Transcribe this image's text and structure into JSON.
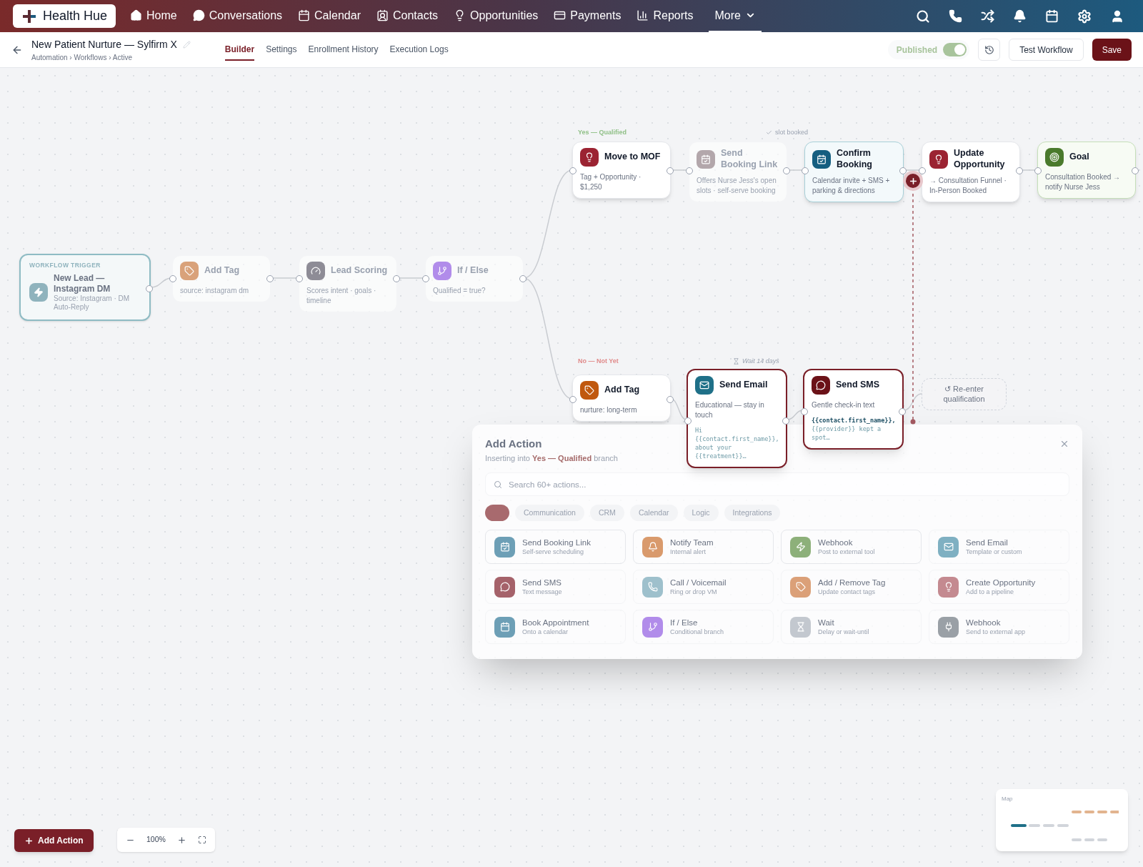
{
  "nav": {
    "brand": "Health Hue",
    "items": [
      {
        "label": "Home",
        "selected": false
      },
      {
        "label": "Conversations",
        "selected": false
      },
      {
        "label": "Calendar",
        "selected": false
      },
      {
        "label": "Contacts",
        "selected": false
      },
      {
        "label": "Opportunities",
        "selected": false
      },
      {
        "label": "Payments",
        "selected": false
      },
      {
        "label": "Reports",
        "selected": false
      },
      {
        "label": "More",
        "selected": true
      }
    ]
  },
  "header": {
    "title": "New Patient Nurture — Sylfirm X",
    "breadcrumb": "Automation › Workflows › Active",
    "tabs": [
      {
        "label": "Builder",
        "selected": true
      },
      {
        "label": "Settings",
        "selected": false
      },
      {
        "label": "Enrollment History",
        "selected": false
      },
      {
        "label": "Execution Logs",
        "selected": false
      }
    ],
    "published": {
      "label": "Published",
      "on": true
    },
    "buttons": [
      "Test Workflow",
      "Save"
    ]
  },
  "canvas": {
    "nodes": [
      {
        "kind": "trigger",
        "label": "WORKFLOW TRIGGER",
        "title": "New Lead — Instagram DM",
        "subtitle": "Source: Instagram · DM Auto-Reply",
        "color": "#8fb3bd"
      },
      {
        "kind": "muted",
        "title": "Add Tag",
        "subtitle": "source: instagram dm",
        "color": "#d9a27a"
      },
      {
        "kind": "muted",
        "title": "Lead Scoring",
        "subtitle": "Scores intent · goals · timeline",
        "color": "#8e8c96"
      },
      {
        "kind": "muted",
        "title": "If / Else",
        "subtitle": "Qualified = true?",
        "color": "#b18cea"
      },
      {
        "kind": "default",
        "title": "Move to MOF",
        "subtitle": "Tag + Opportunity · $1,250",
        "color": "#9b2332"
      },
      {
        "kind": "muted",
        "title": "Send Booking Link",
        "subtitle": "Offers Nurse Jess's open slots · self-serve booking",
        "color": "#b3a7ab"
      },
      {
        "kind": "focus",
        "title": "Confirm Booking",
        "subtitle": "Calendar invite + SMS + parking & directions",
        "color": "#155e80"
      },
      {
        "kind": "default",
        "title": "Update Opportunity",
        "subtitle": "→ Consultation Funnel · In-Person Booked",
        "color": "#9b2332"
      },
      {
        "kind": "goal",
        "title": "Goal",
        "subtitle": "Consultation Booked → notify Nurse Jess",
        "color": "#4a7a2c"
      },
      {
        "kind": "default",
        "title": "Add Tag",
        "subtitle": "nurture: long-term",
        "color": "#c0580e"
      },
      {
        "kind": "selected",
        "title": "Send Email",
        "subtitle": "Educational — stay in touch",
        "code": "Hi {{contact.first_name}}, about your {{treatment}}…",
        "color": "#1f7088"
      },
      {
        "kind": "selected",
        "title": "Send SMS",
        "subtitle": "Gentle check-in text",
        "code": "**{{contact.first_name}},** {{provider}} kept a spot…",
        "color": "#6b1218"
      },
      {
        "kind": "placeholder",
        "title": "↺ Re-enter qualification"
      }
    ],
    "branch_labels": [
      {
        "text": "Yes — Qualified",
        "color": "#8fbf86"
      },
      {
        "text": "No — Not Yet",
        "color": "#e08a8a"
      }
    ],
    "edge_notes": [
      {
        "text": "slot booked"
      },
      {
        "text": "Wait 14 days"
      }
    ]
  },
  "add_action_panel": {
    "title": "Add Action",
    "subtitle": "Inserting into **Yes — Qualified** branch",
    "search": {
      "placeholder": "Search 60+ actions..."
    },
    "chips": [
      {
        "selected": true
      },
      {
        "label": "Communication",
        "selected": false
      },
      {
        "label": "CRM",
        "selected": false
      },
      {
        "label": "Calendar",
        "selected": false
      },
      {
        "label": "Logic",
        "selected": false
      },
      {
        "label": "Integrations",
        "selected": false
      }
    ],
    "actions": [
      {
        "title": "Send Booking Link",
        "subtitle": "Self-serve scheduling",
        "color": "#6d9fb6"
      },
      {
        "title": "Notify Team",
        "subtitle": "Internal alert",
        "color": "#d99a6c"
      },
      {
        "title": "Webhook",
        "subtitle": "Post to external tool",
        "color": "#8db07a"
      },
      {
        "title": "Send Email",
        "subtitle": "Template or custom",
        "color": "#7fb0c2"
      },
      {
        "title": "Send SMS",
        "subtitle": "Text message",
        "color": "#a5626a"
      },
      {
        "title": "Call / Voicemail",
        "subtitle": "Ring or drop VM",
        "color": "#9ec0cc"
      },
      {
        "title": "Add / Remove Tag",
        "subtitle": "Update contact tags",
        "color": "#dba078"
      },
      {
        "title": "Create Opportunity",
        "subtitle": "Add to a pipeline",
        "color": "#c48a90"
      },
      {
        "title": "Book Appointment",
        "subtitle": "Onto a calendar",
        "color": "#6d9fb6"
      },
      {
        "title": "If / Else",
        "subtitle": "Conditional branch",
        "color": "#b18cea"
      },
      {
        "title": "Wait",
        "subtitle": "Delay or wait-until",
        "color": "#c3c8cf"
      },
      {
        "title": "Webhook",
        "subtitle": "Send to external app",
        "color": "#9aa0a6"
      }
    ]
  },
  "minimap": {
    "label": "Map"
  },
  "footer": {
    "add_action": "Add Action",
    "zoom": "100%"
  }
}
